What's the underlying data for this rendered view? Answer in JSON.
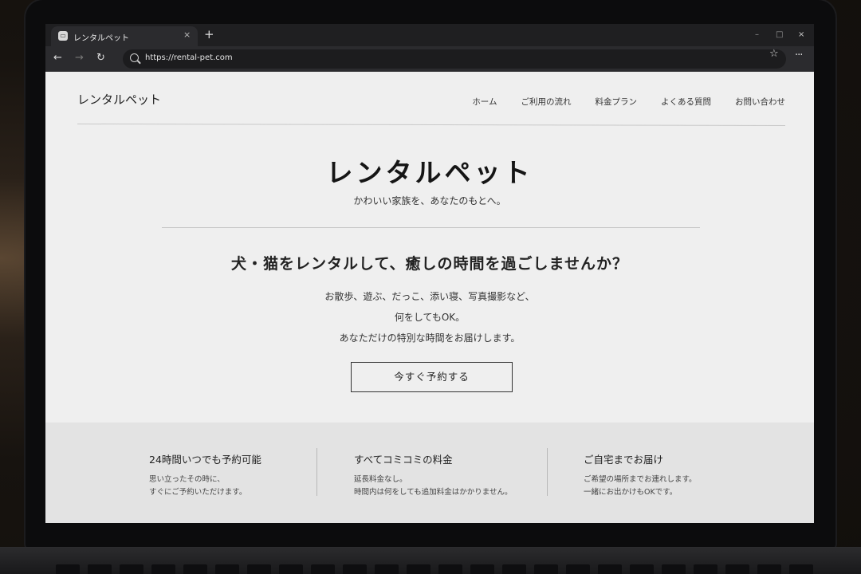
{
  "browser": {
    "tab_title": "レンタルペット",
    "tab_close": "×",
    "new_tab": "+",
    "url": "https://rental-pet.com",
    "back": "←",
    "forward": "→",
    "reload": "↻",
    "bookmark": "☆",
    "menu": "···",
    "minimize": "–",
    "maximize": "□",
    "close": "×"
  },
  "header": {
    "logo": "レンタルペット",
    "nav": [
      "ホーム",
      "ご利用の流れ",
      "料金プラン",
      "よくある質問",
      "お問い合わせ"
    ]
  },
  "hero": {
    "title": "レンタルペット",
    "subtitle": "かわいい家族を、あなたのもとへ。",
    "headline": "犬・猫をレンタルして、癒しの時間を過ごしませんか？",
    "body": [
      "お散歩、遊ぶ、だっこ、添い寝、写真撮影など、",
      "何をしてもOK。",
      "あなただけの特別な時間をお届けします。"
    ],
    "cta": "今すぐ予約する"
  },
  "features": [
    {
      "title": "24時間いつでも予約可能",
      "lines": [
        "思い立ったその時に、",
        "すぐにご予約いただけます。"
      ]
    },
    {
      "title": "すべてコミコミの料金",
      "lines": [
        "延長料金なし。",
        "時間内は何をしても追加料金はかかりません。"
      ]
    },
    {
      "title": "ご自宅までお届け",
      "lines": [
        "ご希望の場所までお連れします。",
        "一緒にお出かけもOKです。"
      ]
    }
  ]
}
